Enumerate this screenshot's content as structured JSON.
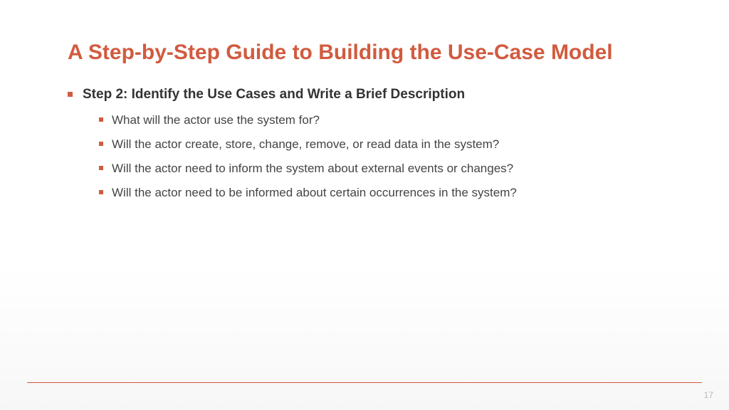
{
  "title": "A Step-by-Step Guide to Building the Use-Case Model",
  "mainBullet": "Step 2: Identify the Use Cases and Write a Brief Description",
  "subBullets": [
    "What will the actor use the system for?",
    "Will the actor create, store, change, remove, or read data in the system?",
    "Will the actor need to inform the system about external events or changes?",
    "Will the actor need to be informed about certain occurrences in the system?"
  ],
  "pageNumber": "17",
  "colors": {
    "accent": "#d15b3f",
    "bodyText": "#444444",
    "boldText": "#333333"
  }
}
